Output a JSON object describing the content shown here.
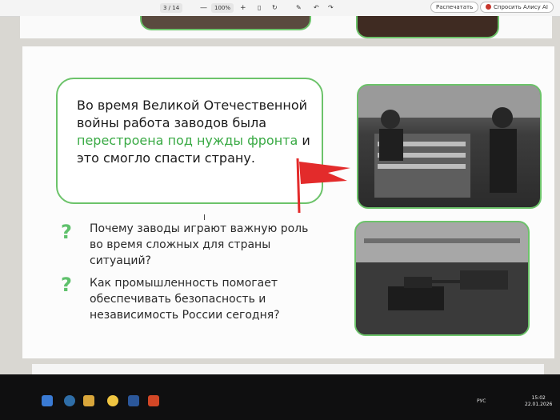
{
  "toolbar": {
    "page_indicator": "3 / 14",
    "zoom_out": "—",
    "zoom": "100%",
    "zoom_in": "+",
    "print_label": "Распечатать",
    "alice_label": "Спросить Алису AI"
  },
  "slide": {
    "text_before": "Во время Великой Отечественной войны работа заводов была ",
    "text_highlight": "перестроена под нужды фронта",
    "text_after": " и это смогло спасти страну.",
    "question_1": "Почему заводы играют важную роль во время сложных для страны ситуаций?",
    "question_2": "Как промышленность помогает обеспечивать безопасность и независимость России сегодня?",
    "question_mark": "?",
    "accent_color": "#3aaa45",
    "flag_color": "#e32b2b"
  },
  "taskbar": {
    "language": "РУС",
    "time": "15:02",
    "date": "22.01.2026"
  }
}
